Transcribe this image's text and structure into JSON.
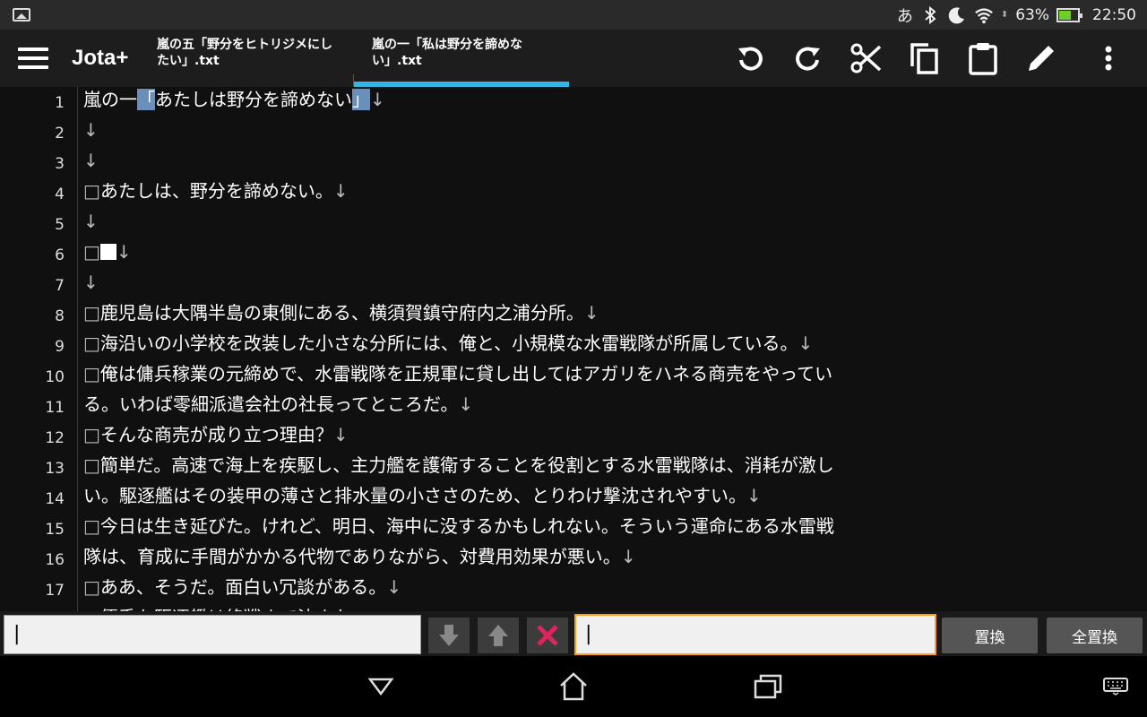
{
  "status_bar": {
    "ime": "あ",
    "battery": "63%",
    "battery_level": 0.63,
    "time": "22:50",
    "icons": [
      "gallery-icon",
      "bluetooth-icon",
      "do-not-disturb-moon-icon",
      "wifi-icon",
      "battery-charging-icon"
    ]
  },
  "action_bar": {
    "app_title": "Jota+",
    "tabs": [
      {
        "label": "嵐の五「野分をヒトリジメにしたい」.txt",
        "active": false
      },
      {
        "label": "嵐の一「私は野分を諦めない」.txt",
        "active": true
      }
    ],
    "tab_accent": "#33b5e5",
    "tools": [
      "undo-icon",
      "redo-icon",
      "cut-icon",
      "copy-icon",
      "paste-icon",
      "edit-icon",
      "overflow-menu-icon"
    ]
  },
  "editor": {
    "line_numbers": [
      "1",
      "2",
      "3",
      "4",
      "5",
      "6",
      "7",
      "8",
      "9",
      "10",
      "11",
      "12",
      "13",
      "14",
      "15",
      "16",
      "17"
    ],
    "lines": [
      {
        "segments": [
          {
            "t": "嵐の一",
            "c": ""
          },
          {
            "t": "「",
            "c": "sel"
          },
          {
            "t": "あたしは野分を諦めない",
            "c": ""
          },
          {
            "t": "」",
            "c": "sel"
          },
          {
            "t": "↓",
            "c": "mark"
          }
        ]
      },
      {
        "segments": [
          {
            "t": "↓",
            "c": "mark"
          }
        ]
      },
      {
        "segments": [
          {
            "t": "↓",
            "c": "mark"
          }
        ]
      },
      {
        "segments": [
          {
            "t": "□",
            "c": "mark"
          },
          {
            "t": "あたしは、野分を諦めない。",
            "c": ""
          },
          {
            "t": "↓",
            "c": "mark"
          }
        ]
      },
      {
        "segments": [
          {
            "t": "↓",
            "c": "mark"
          }
        ]
      },
      {
        "segments": [
          {
            "t": "□",
            "c": "mark"
          },
          {
            "t": "",
            "c": "block"
          },
          {
            "t": "↓",
            "c": "mark"
          }
        ]
      },
      {
        "segments": [
          {
            "t": "↓",
            "c": "mark"
          }
        ]
      },
      {
        "segments": [
          {
            "t": "□",
            "c": "mark"
          },
          {
            "t": "鹿児島は大隅半島の東側にある、横須賀鎮守府内之浦分所。",
            "c": ""
          },
          {
            "t": "↓",
            "c": "mark"
          }
        ]
      },
      {
        "segments": [
          {
            "t": "□",
            "c": "mark"
          },
          {
            "t": "海沿いの小学校を改装した小さな分所には、俺と、小規模な水雷戦隊が所属している。",
            "c": ""
          },
          {
            "t": "↓",
            "c": "mark"
          }
        ]
      },
      {
        "segments": [
          {
            "t": "□",
            "c": "mark"
          },
          {
            "t": "俺は傭兵稼業の元締めで、水雷戦隊を正規軍に貸し出してはアガリをハネる商売をやってい",
            "c": ""
          }
        ]
      },
      {
        "segments": [
          {
            "t": "る。いわば零細派遣会社の社長ってところだ。",
            "c": ""
          },
          {
            "t": "↓",
            "c": "mark"
          }
        ]
      },
      {
        "segments": [
          {
            "t": "□",
            "c": "mark"
          },
          {
            "t": "そんな商売が成り立つ理由？",
            "c": ""
          },
          {
            "t": "↓",
            "c": "mark"
          }
        ]
      },
      {
        "segments": [
          {
            "t": "□",
            "c": "mark"
          },
          {
            "t": "簡単だ。高速で海上を疾駆し、主力艦を護衛することを役割とする水雷戦隊は、消耗が激し",
            "c": ""
          }
        ]
      },
      {
        "segments": [
          {
            "t": "い。駆逐艦はその装甲の薄さと排水量の小ささのため、とりわけ撃沈されやすい。",
            "c": ""
          },
          {
            "t": "↓",
            "c": "mark"
          }
        ]
      },
      {
        "segments": [
          {
            "t": "□",
            "c": "mark"
          },
          {
            "t": "今日は生き延びた。けれど、明日、海中に没するかもしれない。そういう運命にある水雷戦",
            "c": ""
          }
        ]
      },
      {
        "segments": [
          {
            "t": "隊は、育成に手間がかかる代物でありながら、対費用効果が悪い。",
            "c": ""
          },
          {
            "t": "↓",
            "c": "mark"
          }
        ]
      },
      {
        "segments": [
          {
            "t": "□",
            "c": "mark"
          },
          {
            "t": "ああ、そうだ。面白い冗談がある。",
            "c": ""
          },
          {
            "t": "↓",
            "c": "mark"
          }
        ]
      },
      {
        "segments": [
          {
            "t": "□",
            "c": "mark"
          },
          {
            "t": "優秀な駆逐艦は終戦まで沈まない",
            "c": ""
          }
        ]
      }
    ]
  },
  "search_bar": {
    "search_value": "|",
    "replace_value": "|",
    "replace_label": "置換",
    "replace_all_label": "全置換",
    "focus_color": "#ff9c1a",
    "clear_color": "#e0245e"
  },
  "nav_bar": {
    "buttons": [
      "back-icon",
      "home-icon",
      "recents-icon",
      "keyboard-icon"
    ]
  }
}
